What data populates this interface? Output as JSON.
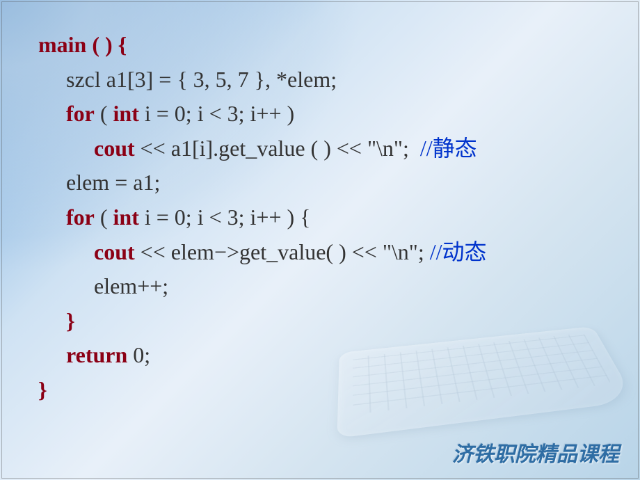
{
  "code": {
    "l1_kw": "main",
    "l1_plain": " ( ) {",
    "l2_plain": "szcl a1[3] = { 3, 5, 7 }, *elem;",
    "l3_kw1": "for",
    "l3_plain1": " ( ",
    "l3_kw2": "int",
    "l3_plain2": " i = 0; i < 3; i++ )",
    "l4_kw": "cout",
    "l4_plain": " << a1[i].get_value ( ) << \"\\n\";  ",
    "l4_comment": "//静态",
    "l5_plain": "elem = a1;",
    "l6_kw1": "for",
    "l6_plain1": " ( ",
    "l6_kw2": "int",
    "l6_plain2": " i = 0; i < 3; i++ ) {",
    "l7_kw": "cout",
    "l7_plain": " << elem−>get_value( ) << \"\\n\"; ",
    "l7_comment": "//动态",
    "l8_plain": "elem++;",
    "l9_kw": "}",
    "l10_kw": "return",
    "l10_plain": " 0;",
    "l11_kw": "}"
  },
  "footer": "济铁职院精品课程"
}
